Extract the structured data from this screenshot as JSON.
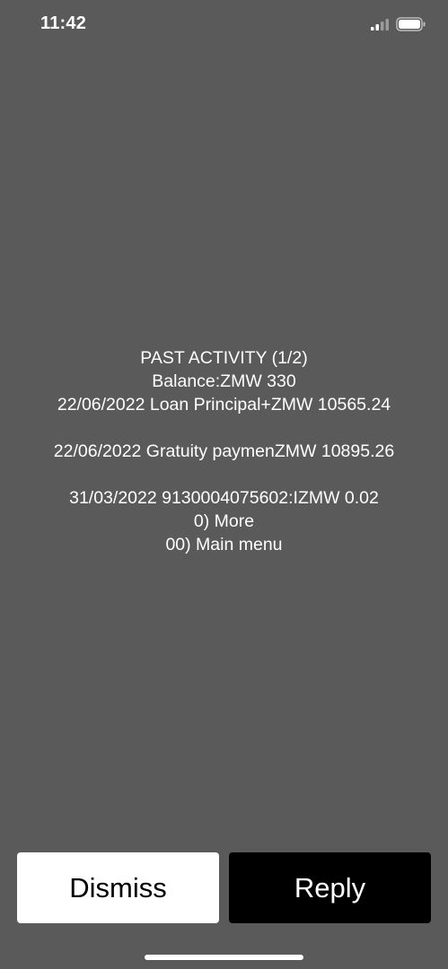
{
  "status_bar": {
    "time": "11:42",
    "icons": [
      "signal-icon",
      "battery-icon"
    ]
  },
  "message": {
    "lines": [
      "PAST ACTIVITY (1/2)",
      "Balance:ZMW 330",
      "22/06/2022 Loan Principal+ZMW 10565.24",
      "",
      "22/06/2022 Gratuity paymenZMW 10895.26",
      "",
      "31/03/2022 9130004075602:IZMW 0.02",
      "0) More",
      "00) Main menu"
    ]
  },
  "actions": {
    "dismiss_label": "Dismiss",
    "reply_label": "Reply"
  },
  "colors": {
    "background": "#5a5a5a",
    "text": "#ffffff",
    "dismiss_bg": "#ffffff",
    "reply_bg": "#000000"
  }
}
